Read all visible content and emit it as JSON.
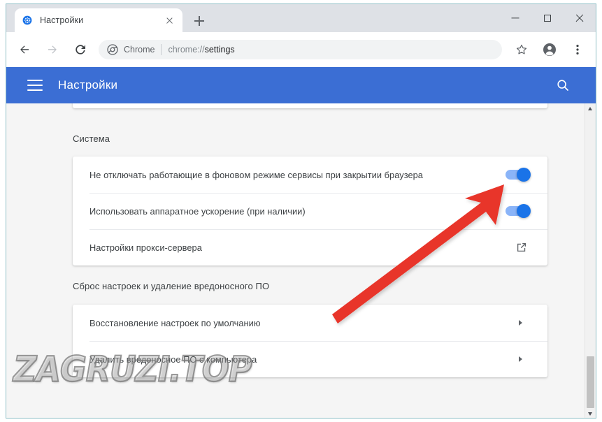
{
  "window": {
    "controls": [
      {
        "name": "minimize",
        "label": "—"
      },
      {
        "name": "maximize",
        "label": "□"
      },
      {
        "name": "close",
        "label": "✕"
      }
    ]
  },
  "tabstrip": {
    "tab": {
      "title": "Настройки",
      "favicon": "gear-icon",
      "close_label": "✕"
    },
    "new_tab_label": "+"
  },
  "toolbar": {
    "back_icon": "back-arrow-icon",
    "forward_icon": "forward-arrow-icon",
    "reload_icon": "reload-icon",
    "omnibox": {
      "site_icon": "chrome-icon",
      "site_label": "Chrome",
      "url_scheme": "chrome://",
      "url_path": "settings",
      "full_url": "chrome://settings"
    },
    "bookmark_icon": "star-icon",
    "profile_icon": "account-avatar-icon",
    "menu_icon": "three-dot-menu-icon"
  },
  "appbar": {
    "menu_icon": "hamburger-menu-icon",
    "title": "Настройки",
    "search_icon": "search-icon",
    "color": "#3b6ed4"
  },
  "page": {
    "sections": [
      {
        "id": "system",
        "title": "Система",
        "rows": [
          {
            "label": "Не отключать работающие в фоновом режиме сервисы при закрытии браузера",
            "control": "toggle",
            "state": "on"
          },
          {
            "label": "Использовать аппаратное ускорение (при наличии)",
            "control": "toggle",
            "state": "on"
          },
          {
            "label": "Настройки прокси-сервера",
            "control": "external-link"
          }
        ]
      },
      {
        "id": "reset",
        "title": "Сброс настроек и удаление вредоносного ПО",
        "rows": [
          {
            "label": "Восстановление настроек по умолчанию",
            "control": "chevron"
          },
          {
            "label": "Удалить вредоносное ПО с компьютера",
            "control": "chevron"
          }
        ]
      }
    ]
  },
  "annotation": {
    "arrow_color": "#e8342a",
    "points_to": "Использовать аппаратное ускорение (при наличии)"
  },
  "watermark": {
    "text": "ZAGRUZI.TOP"
  },
  "scrollbar": {
    "up_icon": "scroll-up-arrow-icon",
    "down_icon": "scroll-down-arrow-icon"
  },
  "colors": {
    "accent": "#1a73e8",
    "appbar": "#3b6ed4",
    "toggle_track": "#8ab4f8",
    "page_bg": "#f5f5f5",
    "card_bg": "#ffffff"
  }
}
